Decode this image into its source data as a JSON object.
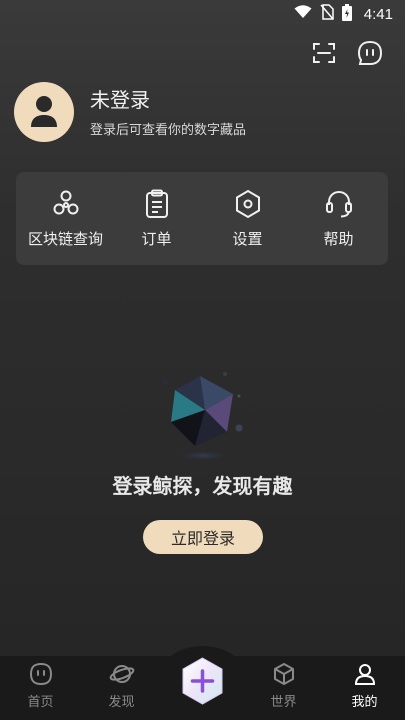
{
  "status_bar": {
    "time": "4:41"
  },
  "profile": {
    "name": "未登录",
    "subtitle": "登录后可查看你的数字藏品"
  },
  "quick_actions": [
    {
      "label": "区块链查询",
      "icon": "blockchain-icon"
    },
    {
      "label": "订单",
      "icon": "order-clipboard-icon"
    },
    {
      "label": "设置",
      "icon": "settings-hexagon-icon"
    },
    {
      "label": "帮助",
      "icon": "headset-icon"
    }
  ],
  "empty_state": {
    "title": "登录鲸探，发现有趣",
    "button_label": "立即登录"
  },
  "tab_bar": {
    "tabs": [
      {
        "label": "首页",
        "icon": "home-icon",
        "active": false
      },
      {
        "label": "发现",
        "icon": "planet-icon",
        "active": false
      },
      {
        "label": "",
        "icon": "plus-icon",
        "active": false
      },
      {
        "label": "世界",
        "icon": "cube-icon",
        "active": false
      },
      {
        "label": "我的",
        "icon": "user-icon",
        "active": true
      }
    ]
  },
  "colors": {
    "accent": "#f0dcbc",
    "background": "#2e2e2e",
    "card": "#3c3c3c",
    "tabbar": "#1a1a1a"
  }
}
